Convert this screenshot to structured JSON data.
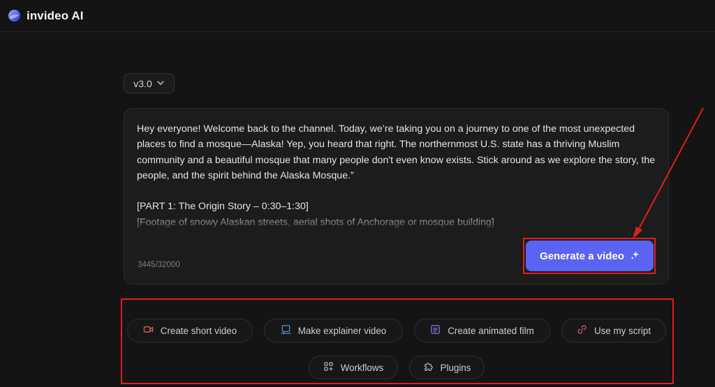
{
  "header": {
    "brand": "invideo AI",
    "logo_icon": "invideo-logo-icon"
  },
  "version_selector": {
    "value": "v3.0",
    "icon": "chevron-down-icon"
  },
  "prompt": {
    "text": "Hey everyone! Welcome back to the channel. Today, we’re taking you on a journey to one of the most unexpected places to find a mosque—Alaska! Yep, you heard that right. The northernmost U.S. state has a thriving Muslim community and a beautiful mosque that many people don't even know exists. Stick around as we explore the story, the people, and the spirit behind the Alaska Mosque.”\n\n[PART 1: The Origin Story – 0:30–1:30]\n[Footage of snowy Alaskan streets, aerial shots of Anchorage or mosque building]",
    "char_count": "3445/32000"
  },
  "generate_button": {
    "label": "Generate a video",
    "icon": "sparkle-icon",
    "color": "#5b63f2"
  },
  "annotations": {
    "highlight_color": "#e01e1e"
  },
  "actions": [
    {
      "label": "Create short video",
      "icon": "video-camera-icon",
      "icon_color": "#e06b5b"
    },
    {
      "label": "Make explainer video",
      "icon": "screen-icon",
      "icon_color": "#5b8fe0"
    },
    {
      "label": "Create animated film",
      "icon": "list-document-icon",
      "icon_color": "#8f7be8"
    },
    {
      "label": "Use my script",
      "icon": "link-icon",
      "icon_color": "#e05b8f"
    },
    {
      "label": "Workflows",
      "icon": "grid-plus-icon",
      "icon_color": "#bdbdbd"
    },
    {
      "label": "Plugins",
      "icon": "puzzle-icon",
      "icon_color": "#bdbdbd"
    }
  ]
}
